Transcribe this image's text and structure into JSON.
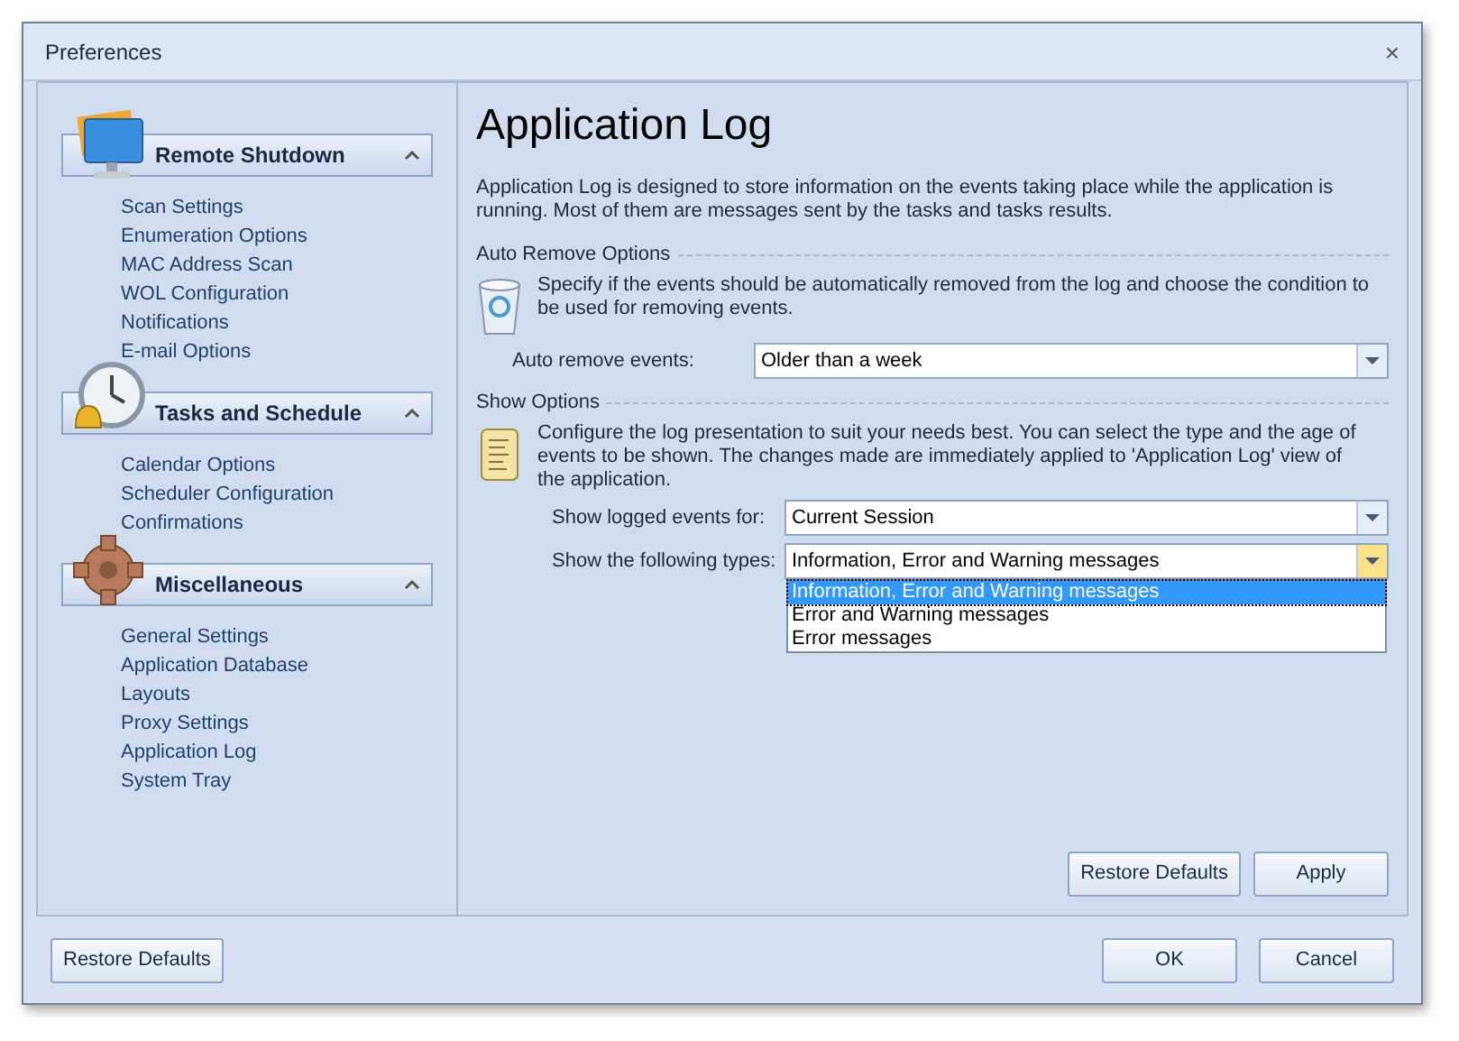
{
  "window": {
    "title": "Preferences",
    "close": "×"
  },
  "sidebar": {
    "groups": [
      {
        "kind": "monitor",
        "title": "Remote Shutdown",
        "expanded": true,
        "items": [
          "Scan Settings",
          "Enumeration Options",
          "MAC Address Scan",
          "WOL Configuration",
          "Notifications",
          "E-mail Options"
        ]
      },
      {
        "kind": "clock",
        "title": "Tasks and Schedule",
        "expanded": true,
        "items": [
          "Calendar Options",
          "Scheduler Configuration",
          "Confirmations"
        ]
      },
      {
        "kind": "gear",
        "title": "Miscellaneous",
        "expanded": true,
        "items": [
          "General Settings",
          "Application Database",
          "Layouts",
          "Proxy Settings",
          "Application Log",
          "System Tray"
        ]
      }
    ]
  },
  "page": {
    "title": "Application Log",
    "intro": "Application Log is designed to store information on the events taking place while the application is running. Most of them are messages sent by the tasks and tasks results.",
    "sections": [
      {
        "kind": "bin",
        "heading": "Auto Remove Options",
        "text": "Specify if the events should be automatically removed from the log and choose the condition to be used for removing events.",
        "fields": [
          {
            "label": "Auto remove events:",
            "value": "Older than a week",
            "open": false
          }
        ]
      },
      {
        "kind": "scroll",
        "heading": "Show Options",
        "text": "Configure the log presentation to suit your needs best. You can select the type and the age of events to be shown. The changes made are immediately applied to 'Application Log' view of the application.",
        "fields": [
          {
            "label": "Show logged events for:",
            "value": "Current Session",
            "open": false
          },
          {
            "label": "Show the following types:",
            "value": "Information, Error and Warning messages",
            "open": true,
            "options": [
              {
                "label": "Information, Error and Warning messages",
                "selected": true
              },
              {
                "label": "Error and Warning messages",
                "selected": false
              },
              {
                "label": "Error messages",
                "selected": false
              }
            ]
          }
        ]
      }
    ],
    "buttons": [
      "Restore Defaults",
      "Apply"
    ]
  },
  "footer": {
    "left_button": "Restore Defaults",
    "buttons": [
      "OK",
      "Cancel"
    ]
  }
}
